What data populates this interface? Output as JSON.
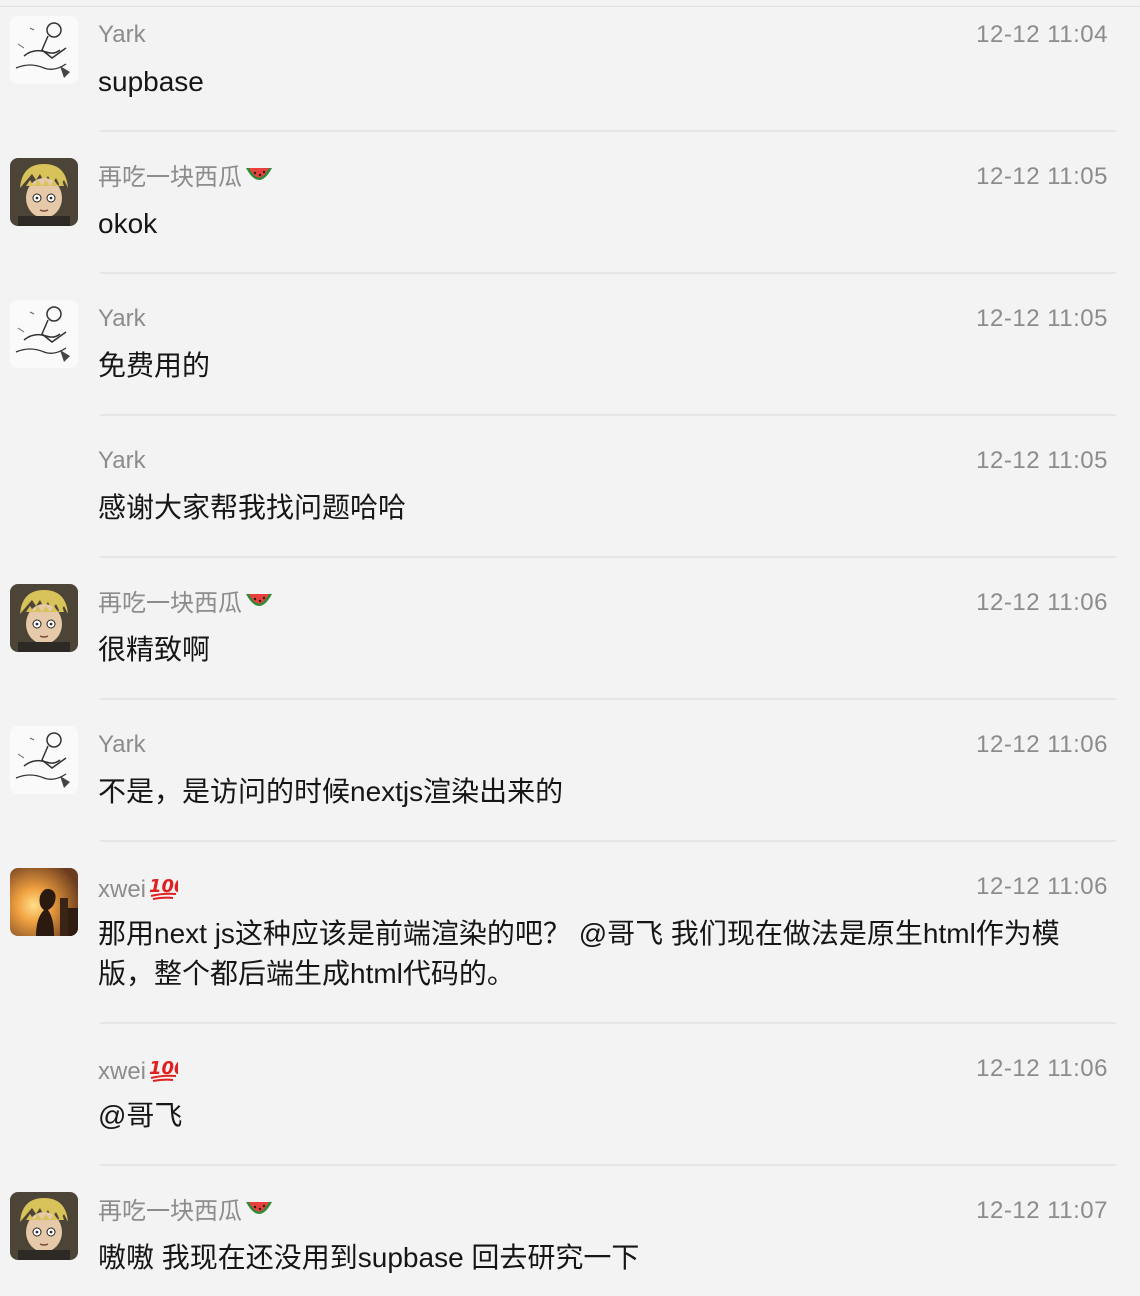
{
  "messages": [
    {
      "avatar": "sketch-avatar-icon",
      "sender": "Yark",
      "emoji": "",
      "time": "12-12 11:04",
      "text": "supbase"
    },
    {
      "avatar": "blond-boy-avatar-icon",
      "sender": "再吃一块西瓜",
      "emoji": "watermelon-icon",
      "time": "12-12 11:05",
      "text": "okok"
    },
    {
      "avatar": "sketch-avatar-icon",
      "sender": "Yark",
      "emoji": "",
      "time": "12-12 11:05",
      "text": "免费用的"
    },
    {
      "avatar": "",
      "sender": "Yark",
      "emoji": "",
      "time": "12-12 11:05",
      "text": "感谢大家帮我找问题哈哈"
    },
    {
      "avatar": "blond-boy-avatar-icon",
      "sender": "再吃一块西瓜",
      "emoji": "watermelon-icon",
      "time": "12-12 11:06",
      "text": "很精致啊"
    },
    {
      "avatar": "sketch-avatar-icon",
      "sender": "Yark",
      "emoji": "",
      "time": "12-12 11:06",
      "text": "不是，是访问的时候nextjs渲染出来的"
    },
    {
      "avatar": "sunset-avatar-icon",
      "sender": "xwei",
      "emoji": "hundred-points-icon",
      "time": "12-12 11:06",
      "text": "那用next js这种应该是前端渲染的吧？ @哥飞 我们现在做法是原生html作为模版，整个都后端生成html代码的。"
    },
    {
      "avatar": "",
      "sender": "xwei",
      "emoji": "hundred-points-icon",
      "time": "12-12 11:06",
      "text": "@哥飞"
    },
    {
      "avatar": "blond-boy-avatar-icon",
      "sender": "再吃一块西瓜",
      "emoji": "watermelon-icon",
      "time": "12-12 11:07",
      "text": "嗷嗷 我现在还没用到supbase 回去研究一下"
    }
  ]
}
